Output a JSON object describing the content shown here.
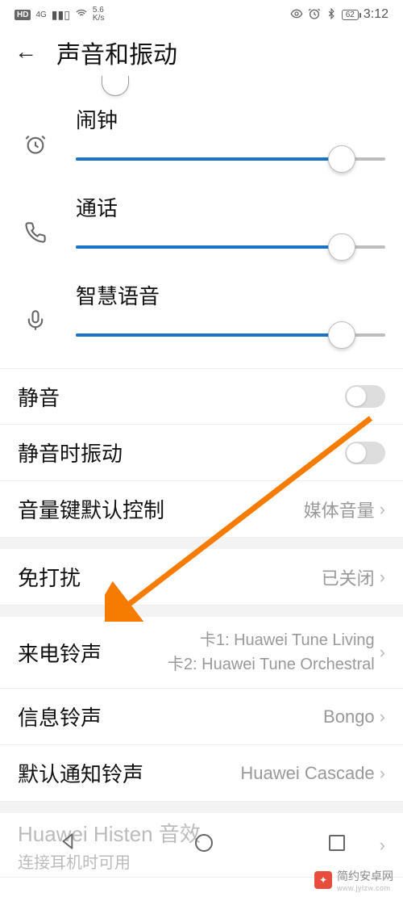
{
  "status": {
    "hd": "HD",
    "signal_4g": "4G",
    "net_speed_top": "5.6",
    "net_speed_bot": "K/s",
    "battery": "62",
    "time": "3:12"
  },
  "header": {
    "title": "声音和振动"
  },
  "sliders": [
    {
      "label": "闹钟",
      "icon": "alarm",
      "value": 86
    },
    {
      "label": "通话",
      "icon": "call",
      "value": 86
    },
    {
      "label": "智慧语音",
      "icon": "mic",
      "value": 86
    }
  ],
  "rows": {
    "mute": {
      "label": "静音"
    },
    "vibrate_on_mute": {
      "label": "静音时振动"
    },
    "volume_key": {
      "label": "音量键默认控制",
      "value": "媒体音量"
    },
    "dnd": {
      "label": "免打扰",
      "value": "已关闭"
    },
    "ringtone": {
      "label": "来电铃声",
      "line1": "卡1: Huawei Tune Living",
      "line2": "卡2: Huawei Tune Orchestral"
    },
    "message_tone": {
      "label": "信息铃声",
      "value": "Bongo"
    },
    "notify_tone": {
      "label": "默认通知铃声",
      "value": "Huawei Cascade"
    },
    "histen": {
      "label": "Huawei Histen 音效",
      "sub": "连接耳机时可用"
    }
  },
  "watermark": {
    "text": "简约安卓网",
    "url": "www.jylzw.com"
  }
}
